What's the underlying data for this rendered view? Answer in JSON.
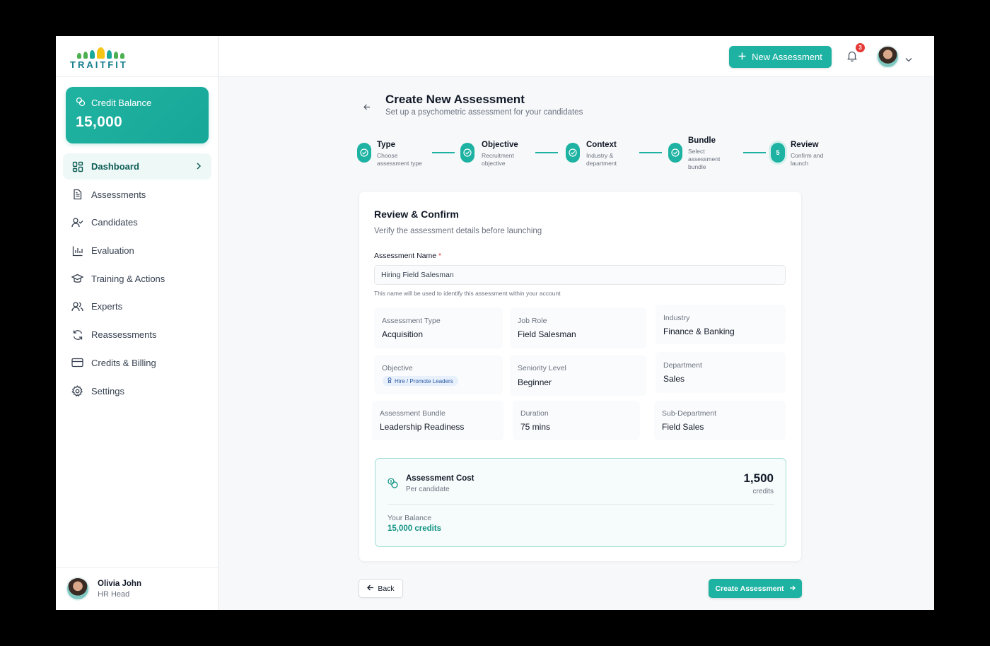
{
  "brand": {
    "name": "TRAITFIT"
  },
  "sidebar": {
    "credit": {
      "label": "Credit Balance",
      "value": "15,000"
    },
    "items": [
      {
        "label": "Dashboard",
        "icon": "dashboard-icon",
        "active": true
      },
      {
        "label": "Assessments",
        "icon": "document-icon"
      },
      {
        "label": "Candidates",
        "icon": "user-check-icon"
      },
      {
        "label": "Evaluation",
        "icon": "bar-chart-icon"
      },
      {
        "label": "Training & Actions",
        "icon": "graduation-cap-icon"
      },
      {
        "label": "Experts",
        "icon": "users-icon"
      },
      {
        "label": "Reassessments",
        "icon": "refresh-icon"
      },
      {
        "label": "Credits & Billing",
        "icon": "credit-card-icon"
      },
      {
        "label": "Settings",
        "icon": "gear-icon"
      }
    ],
    "user": {
      "name": "Olivia John",
      "role": "HR Head"
    }
  },
  "topbar": {
    "new_button": "New Assessment",
    "notifications": "3"
  },
  "page": {
    "title": "Create New Assessment",
    "subtitle": "Set up a psychometric assessment for your candidates"
  },
  "steps": [
    {
      "title": "Type",
      "desc": "Choose assessment type",
      "status": "complete"
    },
    {
      "title": "Objective",
      "desc": "Recruitment objective",
      "status": "complete"
    },
    {
      "title": "Context",
      "desc": "Industry & department",
      "status": "complete"
    },
    {
      "title": "Bundle",
      "desc": "Select assessment bundle",
      "status": "complete"
    },
    {
      "title": "Review",
      "desc": "Confirm and launch",
      "number": "5",
      "status": "current"
    }
  ],
  "review": {
    "title": "Review & Confirm",
    "subtitle": "Verify the assessment details before launching",
    "name_label": "Assessment Name",
    "name_required": "*",
    "name_value": "Hiring Field Salesman",
    "name_hint": "This name will be used to identify this assessment within your account",
    "details": {
      "assessment_type": {
        "label": "Assessment Type",
        "value": "Acquisition"
      },
      "job_role": {
        "label": "Job Role",
        "value": "Field Salesman"
      },
      "industry": {
        "label": "Industry",
        "value": "Finance & Banking"
      },
      "objective": {
        "label": "Objective",
        "value": "Hire / Promote Leaders"
      },
      "seniority": {
        "label": "Seniority Level",
        "value": "Beginner"
      },
      "department": {
        "label": "Department",
        "value": "Sales"
      },
      "bundle": {
        "label": "Assessment Bundle",
        "value": "Leadership Readiness"
      },
      "duration": {
        "label": "Duration",
        "value": "75 mins"
      },
      "sub_department": {
        "label": "Sub-Department",
        "value": "Field Sales"
      }
    },
    "cost": {
      "title": "Assessment Cost",
      "subtitle": "Per candidate",
      "value": "1,500",
      "unit": "credits",
      "balance_label": "Your Balance",
      "balance_value": "15,000 credits"
    }
  },
  "actions": {
    "back": "Back",
    "create": "Create Assessment"
  },
  "colors": {
    "accent": "#1db2a2",
    "accent_dark": "#149485",
    "danger": "#e53935"
  }
}
